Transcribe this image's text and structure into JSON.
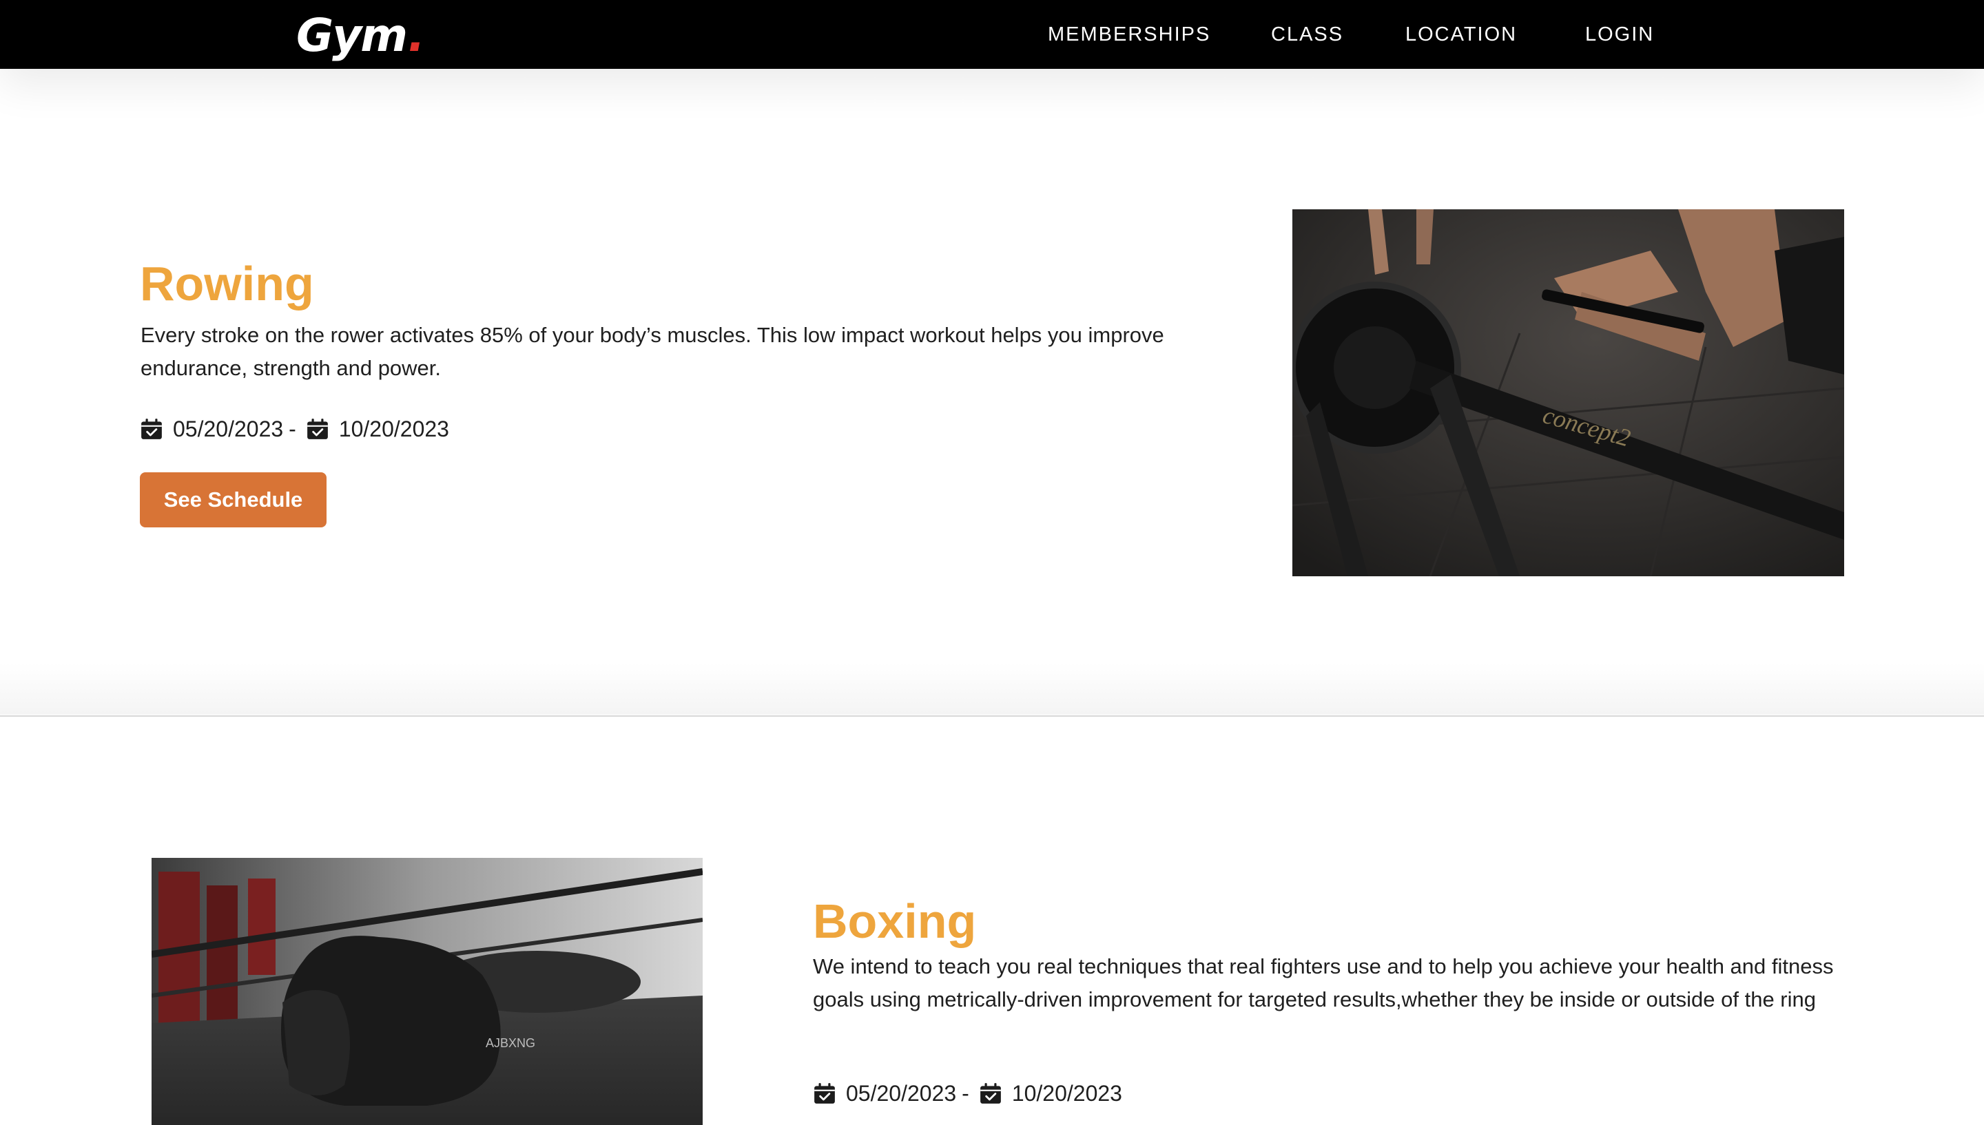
{
  "nav": {
    "logo": "Gym",
    "logo_dot": ".",
    "links": [
      "MEMBERSHIPS",
      "CLASS",
      "LOCATION",
      "LOGIN"
    ]
  },
  "classes": [
    {
      "title": "Rowing",
      "description": "Every stroke on the rower activates 85% of your body’s muscles. This low impact workout helps you improve endurance, strength and power.",
      "start_date": "05/20/2023",
      "separator": "-",
      "end_date": "10/20/2023",
      "button_label": "See Schedule",
      "image_text": "concept2"
    },
    {
      "title": "Boxing",
      "description": "We intend to teach you real techniques that real fighters use and to help you achieve your health and fitness goals using metrically-driven improvement for targeted results,whether they be inside or outside of the ring",
      "start_date": "05/20/2023",
      "separator": "-",
      "end_date": "10/20/2023",
      "image_text": "AJBXNG"
    }
  ],
  "colors": {
    "navbar_bg": "#000000",
    "logo_dot": "#e0322b",
    "title": "#eea53d",
    "button": "#d87436"
  },
  "icons": [
    "calendar-check-icon"
  ]
}
